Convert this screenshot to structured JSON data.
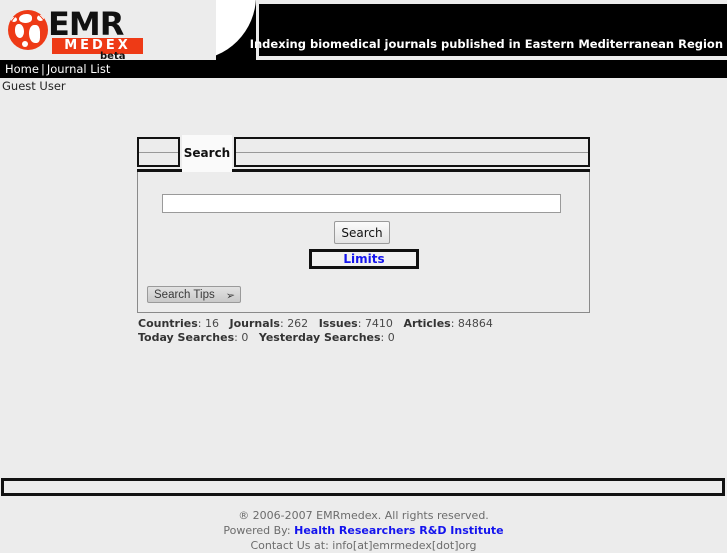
{
  "header": {
    "logo": {
      "brand_main": "EMR",
      "brand_sub": "MEDEX",
      "brand_tag": "beta",
      "globe_icon": "globe-icon"
    },
    "tagline": "Indexing biomedical journals published in Eastern Mediterranean Region"
  },
  "nav": {
    "items": [
      {
        "label": "Home"
      },
      {
        "label": "Journal List"
      }
    ],
    "separator": "|"
  },
  "user": {
    "status": "Guest User"
  },
  "tabs": [
    {
      "label": "",
      "active": false
    },
    {
      "label": "Search",
      "active": true
    },
    {
      "label": "",
      "active": false
    }
  ],
  "search": {
    "input_value": "",
    "input_placeholder": "",
    "search_button": "Search",
    "limits_link": "Limits",
    "tips_button": "Search Tips",
    "tips_arrow_icon": "arrow-down-right-icon"
  },
  "stats": {
    "line1": [
      {
        "label": "Countries",
        "value": "16"
      },
      {
        "label": "Journals",
        "value": "262"
      },
      {
        "label": "Issues",
        "value": "7410"
      },
      {
        "label": "Articles",
        "value": "84864"
      }
    ],
    "line2": [
      {
        "label": "Today Searches",
        "value": "0"
      },
      {
        "label": "Yesterday Searches",
        "value": "0"
      }
    ]
  },
  "footer": {
    "copyright": "® 2006-2007 EMRmedex. All rights reserved.",
    "powered_prefix": "Powered By:",
    "powered_link": "Health Researchers R&D Institute",
    "contact": "Contact Us at: info[at]emrmedex[dot]org"
  },
  "colors": {
    "brand_orange": "#ee3a16",
    "link_blue": "#1414ee",
    "page_bg": "#ececec",
    "bar_black": "#000000"
  }
}
